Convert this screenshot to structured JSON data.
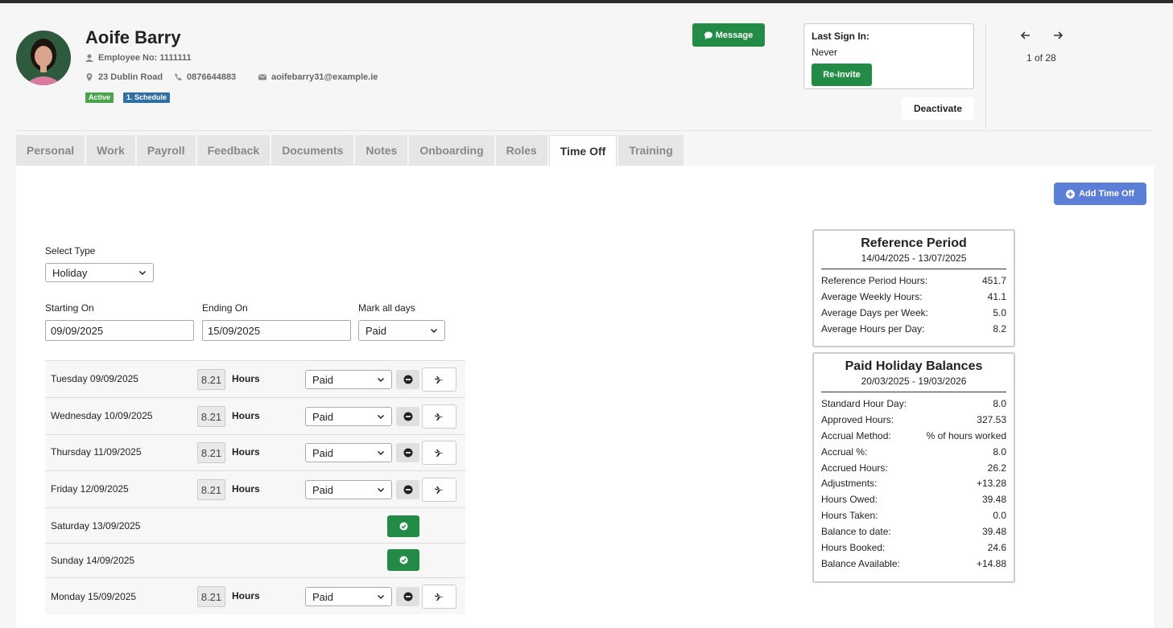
{
  "employee": {
    "name": "Aoife Barry",
    "employee_no": "Employee No: 1111111",
    "address": "23 Dublin Road",
    "phone": "0876644883",
    "email": "aoifebarry31@example.ie",
    "badges": [
      {
        "label": "Active",
        "color": "#4aa54a"
      },
      {
        "label": "1. Schedule",
        "color": "#2f6fa5"
      }
    ]
  },
  "header": {
    "message_label": "Message",
    "last_sign_in_label": "Last Sign In:",
    "last_sign_in_value": "Never",
    "reinvite_label": "Re-Invite",
    "deactivate_label": "Deactivate",
    "pager": "1 of 28"
  },
  "tabs": [
    "Personal",
    "Work",
    "Payroll",
    "Feedback",
    "Documents",
    "Notes",
    "Onboarding",
    "Roles",
    "Time Off",
    "Training"
  ],
  "active_tab": "Time Off",
  "timeoff": {
    "add_label": "Add Time Off",
    "select_type_label": "Select Type",
    "select_type_value": "Holiday",
    "starting_on_label": "Starting On",
    "starting_on_value": "09/09/2025",
    "ending_on_label": "Ending On",
    "ending_on_value": "15/09/2025",
    "mark_all_label": "Mark all days",
    "mark_all_value": "Paid",
    "hours_label": "Hours",
    "days": [
      {
        "label": "Tuesday 09/09/2025",
        "hours": "8.21",
        "status": "Paid",
        "weekend": false
      },
      {
        "label": "Wednesday 10/09/2025",
        "hours": "8.21",
        "status": "Paid",
        "weekend": false
      },
      {
        "label": "Thursday 11/09/2025",
        "hours": "8.21",
        "status": "Paid",
        "weekend": false
      },
      {
        "label": "Friday 12/09/2025",
        "hours": "8.21",
        "status": "Paid",
        "weekend": false
      },
      {
        "label": "Saturday 13/09/2025",
        "weekend": true
      },
      {
        "label": "Sunday 14/09/2025",
        "weekend": true
      },
      {
        "label": "Monday 15/09/2025",
        "hours": "8.21",
        "status": "Paid",
        "weekend": false
      }
    ]
  },
  "reference_period": {
    "title": "Reference Period",
    "dates": "14/04/2025 - 13/07/2025",
    "rows": [
      {
        "label": "Reference Period Hours:",
        "value": "451.7"
      },
      {
        "label": "Average Weekly Hours:",
        "value": "41.1"
      },
      {
        "label": "Average Days per Week:",
        "value": "5.0"
      },
      {
        "label": "Average Hours per Day:",
        "value": "8.2"
      }
    ]
  },
  "holiday_balances": {
    "title": "Paid Holiday Balances",
    "dates": "20/03/2025 - 19/03/2026",
    "rows": [
      {
        "label": "Standard Hour Day:",
        "value": "8.0"
      },
      {
        "label": "Approved Hours:",
        "value": "327.53"
      },
      {
        "label": "Accrual Method:",
        "value": "% of hours worked"
      },
      {
        "label": "Accrual %:",
        "value": "8.0"
      },
      {
        "label": "Accrued Hours:",
        "value": "26.2"
      },
      {
        "label": "Adjustments:",
        "value": "+13.28"
      },
      {
        "label": "Hours Owed:",
        "value": "39.48"
      },
      {
        "label": "Hours Taken:",
        "value": "0.0"
      },
      {
        "label": "Balance to date:",
        "value": "39.48"
      },
      {
        "label": "Hours Booked:",
        "value": "24.6"
      },
      {
        "label": "Balance Available:",
        "value": "+14.88"
      }
    ]
  }
}
